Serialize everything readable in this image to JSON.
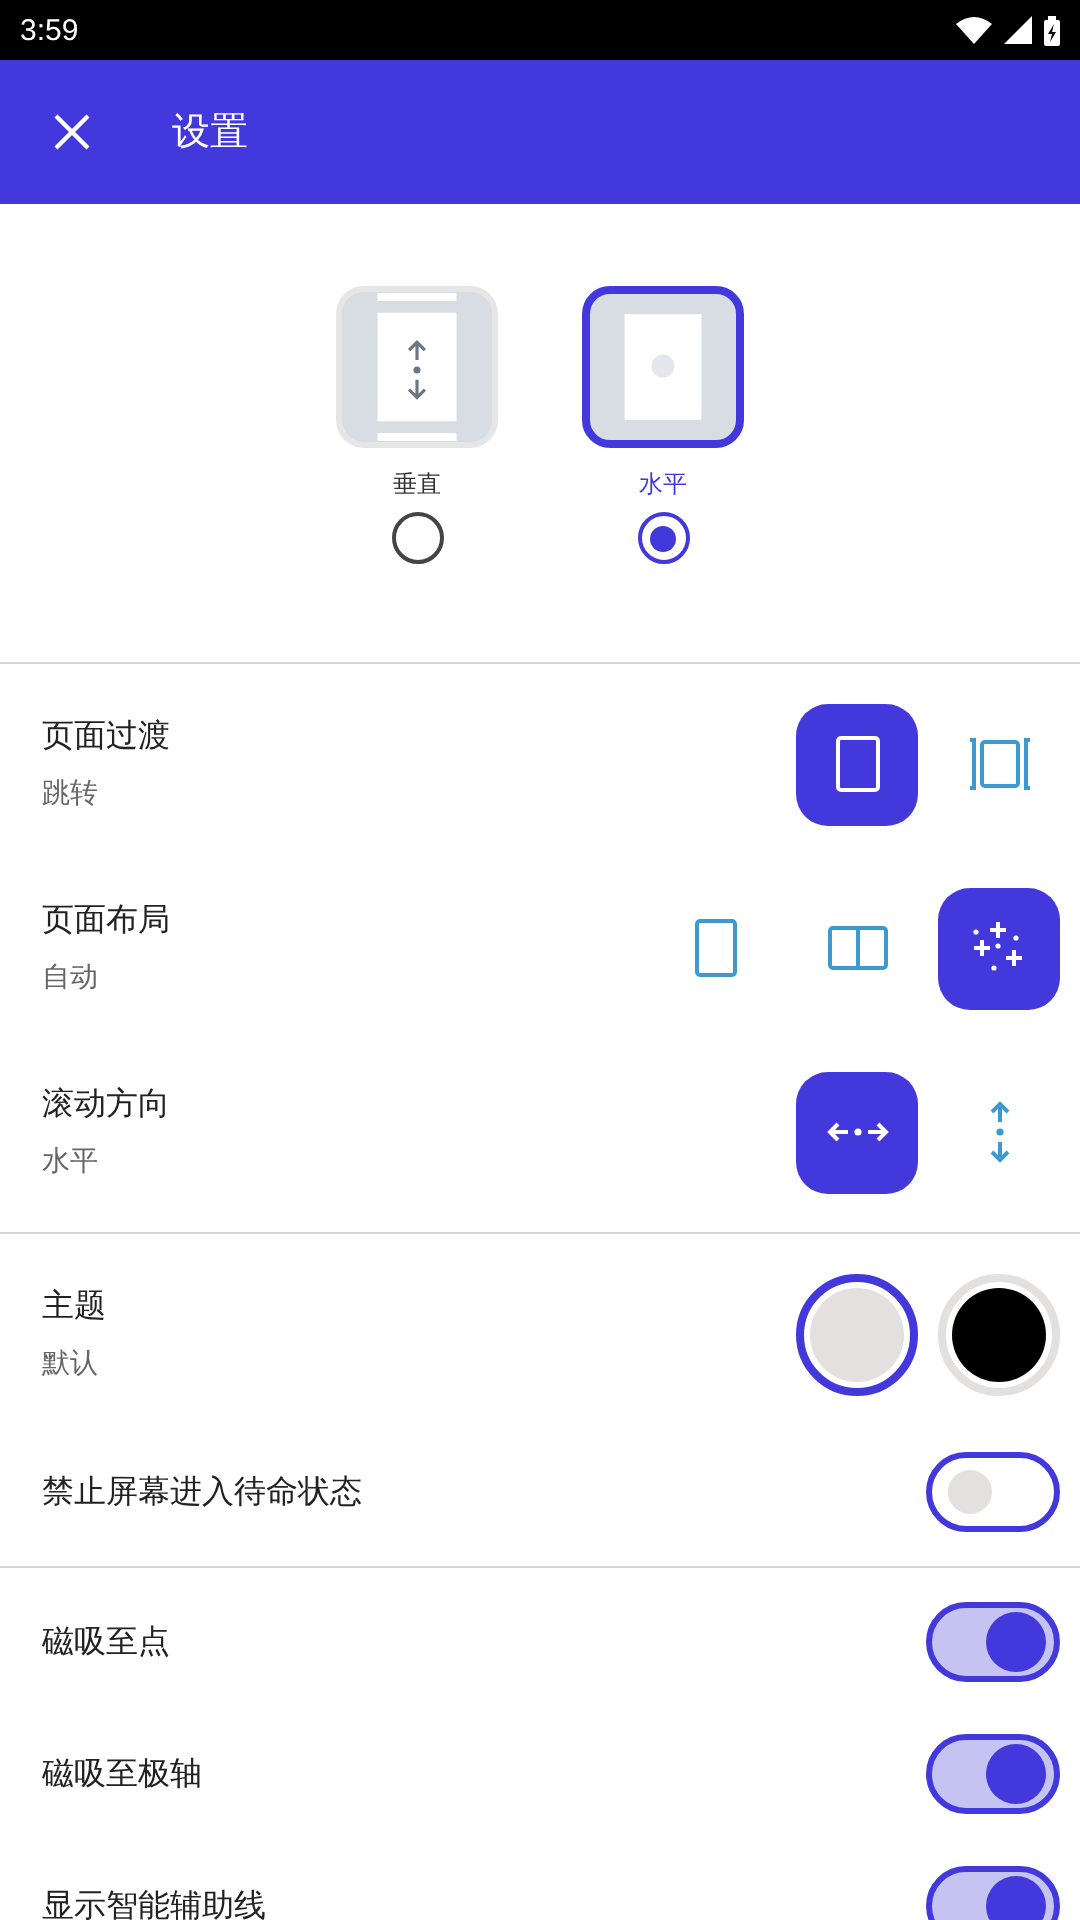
{
  "status_bar": {
    "time": "3:59"
  },
  "app_bar": {
    "title": "设置"
  },
  "reading_mode": [
    {
      "kind": "vertical",
      "label": "垂直",
      "selected": false
    },
    {
      "kind": "horizontal",
      "label": "水平",
      "selected": true
    }
  ],
  "sections": [
    {
      "rows": [
        {
          "kind": "choice",
          "title": "页面过渡",
          "subtitle": "跳转",
          "options": [
            {
              "kind": "page",
              "selected": true
            },
            {
              "kind": "continuous",
              "selected": false
            }
          ]
        },
        {
          "kind": "choice",
          "title": "页面布局",
          "subtitle": "自动",
          "options": [
            {
              "kind": "single",
              "selected": false
            },
            {
              "kind": "double",
              "selected": false
            },
            {
              "kind": "auto",
              "selected": true
            }
          ]
        },
        {
          "kind": "choice",
          "title": "滚动方向",
          "subtitle": "水平",
          "options": [
            {
              "kind": "horizontal",
              "selected": true
            },
            {
              "kind": "vertical",
              "selected": false
            }
          ]
        }
      ]
    },
    {
      "rows": [
        {
          "kind": "theme",
          "title": "主题",
          "subtitle": "默认",
          "swatches": [
            {
              "color": "#e3e0df",
              "selected": true
            },
            {
              "color": "#000000",
              "selected": false
            }
          ]
        },
        {
          "kind": "toggle",
          "title": "禁止屏幕进入待命状态",
          "on": false
        }
      ]
    },
    {
      "rows": [
        {
          "kind": "toggle",
          "title": "磁吸至点",
          "on": true
        },
        {
          "kind": "toggle",
          "title": "磁吸至极轴",
          "on": true
        },
        {
          "kind": "toggle",
          "title": "显示智能辅助线",
          "on": true
        }
      ]
    }
  ]
}
